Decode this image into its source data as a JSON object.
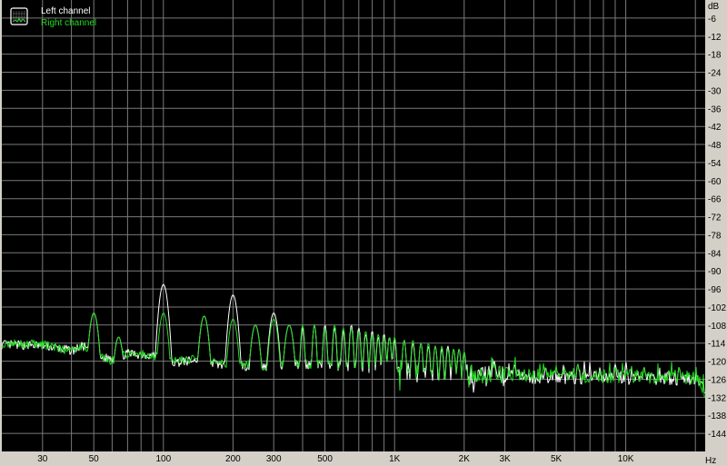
{
  "chart_data": {
    "type": "line",
    "title": "",
    "xlabel": "Hz",
    "ylabel": "dB",
    "x_scale": "log",
    "xlim": [
      20,
      22050
    ],
    "ylim": [
      -150,
      0
    ],
    "grid": true,
    "legend_placement": "top-left",
    "x_ticks": [
      {
        "value": 30,
        "label": "30"
      },
      {
        "value": 50,
        "label": "50"
      },
      {
        "value": 100,
        "label": "100"
      },
      {
        "value": 200,
        "label": "200"
      },
      {
        "value": 300,
        "label": "300"
      },
      {
        "value": 500,
        "label": "500"
      },
      {
        "value": 1000,
        "label": "1K"
      },
      {
        "value": 2000,
        "label": "2K"
      },
      {
        "value": 3000,
        "label": "3K"
      },
      {
        "value": 5000,
        "label": "5K"
      },
      {
        "value": 10000,
        "label": "10K"
      }
    ],
    "y_ticks": [
      -6,
      -12,
      -18,
      -24,
      -30,
      -36,
      -42,
      -48,
      -54,
      -60,
      -66,
      -72,
      -78,
      -84,
      -90,
      -96,
      -102,
      -108,
      -114,
      -120,
      -126,
      -132,
      -138,
      -144
    ],
    "series": [
      {
        "name": "Left channel",
        "color": "#ffffff",
        "noise_floor": [
          [
            20,
            -114.5
          ],
          [
            30,
            -114.8
          ],
          [
            40,
            -116.5
          ],
          [
            45,
            -115
          ],
          [
            52,
            -119
          ],
          [
            60,
            -119
          ],
          [
            70,
            -117.5
          ],
          [
            90,
            -118
          ],
          [
            110,
            -120.5
          ],
          [
            150,
            -119.5
          ],
          [
            170,
            -121
          ],
          [
            250,
            -122
          ],
          [
            400,
            -121
          ],
          [
            700,
            -122
          ],
          [
            1000,
            -123
          ],
          [
            1500,
            -124
          ],
          [
            2000,
            -124.5
          ],
          [
            3000,
            -125
          ],
          [
            5000,
            -125.5
          ],
          [
            10000,
            -125.5
          ],
          [
            20000,
            -126
          ],
          [
            22050,
            -131
          ]
        ],
        "peaks": [
          [
            50,
            -104
          ],
          [
            64,
            -112
          ],
          [
            100,
            -94.5
          ],
          [
            150,
            -105
          ],
          [
            200,
            -98
          ],
          [
            250,
            -108
          ],
          [
            300,
            -104
          ],
          [
            350,
            -108
          ],
          [
            400,
            -109
          ],
          [
            450,
            -108
          ],
          [
            500,
            -108
          ],
          [
            550,
            -109
          ],
          [
            600,
            -110
          ],
          [
            650,
            -108
          ],
          [
            700,
            -109
          ],
          [
            750,
            -111
          ],
          [
            800,
            -110
          ],
          [
            850,
            -112
          ],
          [
            900,
            -111
          ],
          [
            950,
            -112
          ],
          [
            1000,
            -113
          ],
          [
            1100,
            -113
          ],
          [
            1200,
            -114
          ],
          [
            1300,
            -114
          ],
          [
            1400,
            -115
          ],
          [
            1500,
            -115
          ],
          [
            1600,
            -116
          ],
          [
            1700,
            -115
          ],
          [
            1800,
            -116
          ],
          [
            1900,
            -116
          ],
          [
            2000,
            -117
          ],
          [
            2700,
            -120
          ],
          [
            3300,
            -121
          ],
          [
            4500,
            -122
          ],
          [
            6200,
            -121
          ],
          [
            9000,
            -121
          ],
          [
            12000,
            -122
          ],
          [
            17000,
            -122
          ]
        ]
      },
      {
        "name": "Right channel",
        "color": "#22dd22",
        "noise_floor": [
          [
            20,
            -114
          ],
          [
            30,
            -114.5
          ],
          [
            40,
            -116.5
          ],
          [
            45,
            -115
          ],
          [
            52,
            -118
          ],
          [
            60,
            -120
          ],
          [
            70,
            -117.5
          ],
          [
            90,
            -118
          ],
          [
            110,
            -120
          ],
          [
            150,
            -119
          ],
          [
            170,
            -120.5
          ],
          [
            250,
            -121.5
          ],
          [
            400,
            -121
          ],
          [
            700,
            -121.5
          ],
          [
            1000,
            -122.5
          ],
          [
            1500,
            -123.5
          ],
          [
            2000,
            -124
          ],
          [
            3000,
            -124.5
          ],
          [
            5000,
            -125
          ],
          [
            10000,
            -125
          ],
          [
            20000,
            -125.5
          ],
          [
            22050,
            -130
          ]
        ],
        "peaks": [
          [
            50,
            -104
          ],
          [
            64,
            -112
          ],
          [
            100,
            -104
          ],
          [
            150,
            -105
          ],
          [
            200,
            -106
          ],
          [
            250,
            -108
          ],
          [
            300,
            -106
          ],
          [
            350,
            -108
          ],
          [
            400,
            -108
          ],
          [
            450,
            -108
          ],
          [
            500,
            -109
          ],
          [
            550,
            -108
          ],
          [
            600,
            -109
          ],
          [
            650,
            -109
          ],
          [
            700,
            -110
          ],
          [
            750,
            -110
          ],
          [
            800,
            -111
          ],
          [
            850,
            -111
          ],
          [
            900,
            -112
          ],
          [
            950,
            -112
          ],
          [
            1000,
            -112
          ],
          [
            1100,
            -113
          ],
          [
            1200,
            -113
          ],
          [
            1300,
            -114
          ],
          [
            1400,
            -114
          ],
          [
            1500,
            -115
          ],
          [
            1600,
            -115
          ],
          [
            1700,
            -116
          ],
          [
            1800,
            -116
          ],
          [
            1900,
            -116
          ],
          [
            2000,
            -117
          ],
          [
            2700,
            -121
          ],
          [
            3300,
            -121
          ],
          [
            4500,
            -122
          ],
          [
            6200,
            -121
          ],
          [
            9000,
            -122
          ],
          [
            12000,
            -122
          ],
          [
            17000,
            -122
          ]
        ]
      }
    ]
  }
}
